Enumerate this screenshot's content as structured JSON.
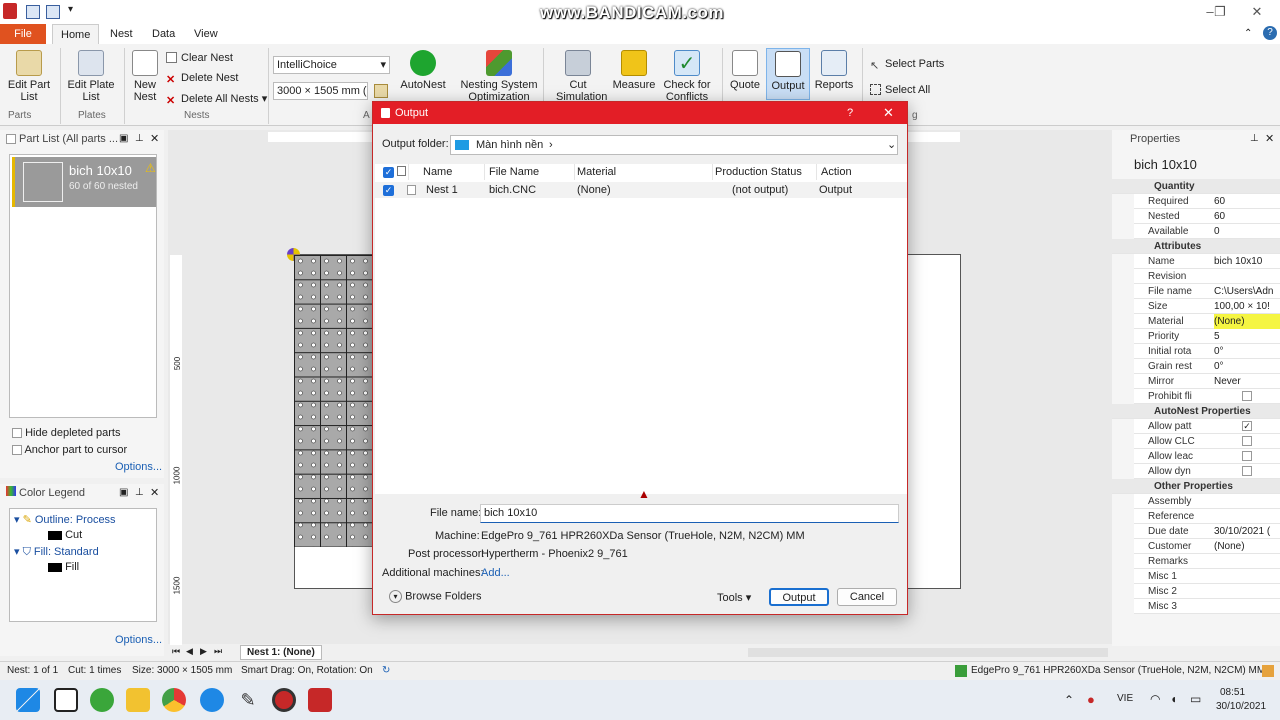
{
  "watermark": "www.BANDICAM.com",
  "ribbon": {
    "tabs": [
      "File",
      "Home",
      "Nest",
      "Data",
      "View"
    ],
    "edit_part": "Edit Part\nList",
    "edit_plate": "Edit Plate\nList",
    "new_nest": "New\nNest",
    "clear_nest": "Clear Nest",
    "delete_nest": "Delete Nest",
    "delete_all_nests": "Delete All Nests",
    "intellichoice": "IntelliChoice",
    "plate_size": "3000 × 1505 mm (I",
    "autonest": "AutoNest",
    "nesting_system": "Nesting System",
    "nesting_system_2": "Optimization",
    "cut": "Cut",
    "cut_2": "Simulation",
    "measure": "Measure",
    "check_for": "Check for",
    "check_for_2": "Conflicts",
    "quote": "Quote",
    "output": "Output",
    "reports": "Reports",
    "select_parts": "Select Parts",
    "select_all": "Select All",
    "group_parts": "Parts",
    "group_plates": "Plates",
    "group_nests": "Nests",
    "group_a": "A",
    "group_g": "g"
  },
  "part_list": {
    "header": "Part List  (All parts ...",
    "part_name": "bich 10x10",
    "part_nested": "60 of 60 nested",
    "hide_depleted": "Hide depleted parts",
    "anchor": "Anchor part to cursor",
    "options": "Options..."
  },
  "color_legend": {
    "header": "Color Legend",
    "outline": "Outline: Process",
    "cut": "Cut",
    "fill": "Fill: Standard",
    "fill_item": "Fill",
    "options": "Options..."
  },
  "ruler": [
    "500",
    "1000",
    "1500"
  ],
  "nest_tab": "Nest 1: (None)",
  "properties": {
    "header": "Properties",
    "title": "bich 10x10",
    "sections": [
      {
        "name": "Quantity",
        "rows": [
          [
            "Required",
            "60"
          ],
          [
            "Nested",
            "60"
          ],
          [
            "Available",
            "0"
          ]
        ]
      },
      {
        "name": "Attributes",
        "rows": [
          [
            "Name",
            "bich 10x10"
          ],
          [
            "Revision",
            ""
          ],
          [
            "File name",
            "C:\\Users\\Adn"
          ],
          [
            "Size",
            "100,00 × 10!"
          ],
          [
            "Material",
            "(None)"
          ],
          [
            "Priority",
            "5"
          ],
          [
            "Initial rota",
            "0°"
          ],
          [
            "Grain rest",
            "0°"
          ],
          [
            "Mirror",
            "Never"
          ],
          [
            "Prohibit fli",
            ""
          ]
        ]
      },
      {
        "name": "AutoNest Properties",
        "rows": [
          [
            "Allow patt",
            ""
          ],
          [
            "Allow CLC",
            ""
          ],
          [
            "Allow leac",
            ""
          ],
          [
            "Allow dyn",
            ""
          ]
        ]
      },
      {
        "name": "Other Properties",
        "rows": [
          [
            "Assembly",
            ""
          ],
          [
            "Reference",
            ""
          ],
          [
            "Due date",
            "30/10/2021 ("
          ],
          [
            "Customer",
            "(None)"
          ],
          [
            "Remarks",
            ""
          ],
          [
            "Misc 1",
            ""
          ],
          [
            "Misc 2",
            ""
          ],
          [
            "Misc 3",
            ""
          ]
        ]
      }
    ]
  },
  "dialog": {
    "title": "Output",
    "help": "?",
    "output_folder_label": "Output folder:",
    "output_folder": "Màn hình nền",
    "columns": [
      "Name",
      "File Name",
      "Material",
      "Production Status",
      "Action"
    ],
    "rows": [
      [
        "Nest 1",
        "bich.CNC",
        "(None)",
        "(not output)",
        "Output"
      ]
    ],
    "file_name_label": "File name:",
    "file_name": "bich 10x10",
    "machine_label": "Machine:",
    "machine": "EdgePro 9_761 HPR260XDa Sensor (TrueHole, N2M, N2CM) MM",
    "post_label": "Post processor:",
    "post": "Hypertherm - Phoenix2 9_761",
    "additional_label": "Additional machines:",
    "additional": "Add...",
    "browse": "Browse Folders",
    "tools": "Tools",
    "output_btn": "Output",
    "cancel_btn": "Cancel"
  },
  "status": {
    "nest": "Nest: 1 of 1",
    "cut": "Cut: 1 times",
    "size": "Size: 3000 × 1505 mm",
    "smart": "Smart Drag: On, Rotation: On",
    "machine": "EdgePro 9_761 HPR260XDa Sensor (TrueHole, N2M, N2CM) MM"
  },
  "taskbar": {
    "lang": "VIE",
    "time": "08:51",
    "date": "30/10/2021"
  }
}
